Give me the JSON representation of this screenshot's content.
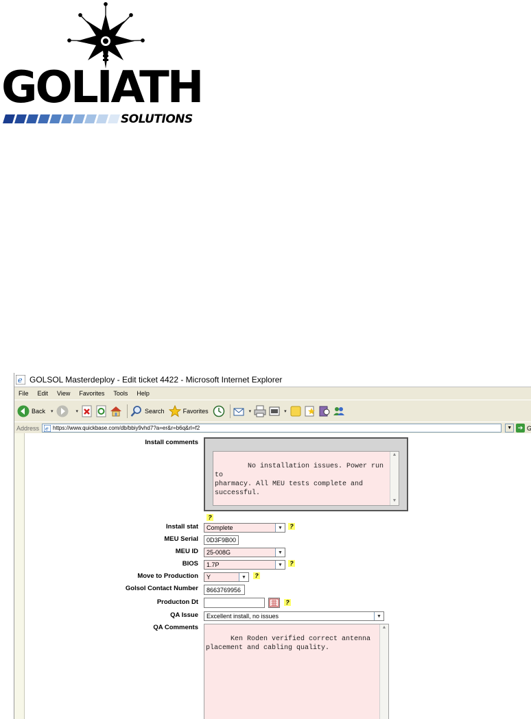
{
  "logo": {
    "main_text": "GOLIATH",
    "sub_text": "SOLUTIONS"
  },
  "window": {
    "title": "GOLSOL Masterdeploy - Edit ticket 4422 - Microsoft Internet Explorer",
    "menu": [
      "File",
      "Edit",
      "View",
      "Favorites",
      "Tools",
      "Help"
    ],
    "toolbar": {
      "back": "Back",
      "search": "Search",
      "favorites": "Favorites"
    },
    "address_label": "Address",
    "address_url": "https://www.quickbase.com/db/bbiy9vhd7?a=er&r=b6q&rl=f2",
    "go_label": "G"
  },
  "form": {
    "install_comments": {
      "label": "Install comments",
      "value": "No installation issues. Power run to\npharmacy. All MEU tests complete and\nsuccessful."
    },
    "install_stat": {
      "label": "Install stat",
      "value": "Complete"
    },
    "meu_serial": {
      "label": "MEU Serial",
      "value": "0D3F9B00"
    },
    "meu_id": {
      "label": "MEU ID",
      "value": "25-008G"
    },
    "bios": {
      "label": "BIOS",
      "value": "1.7P"
    },
    "move_to_production": {
      "label": "Move to Production",
      "value": "Y"
    },
    "golsol_contact": {
      "label": "Golsol Contact Number",
      "value": "8663769956"
    },
    "production_dt": {
      "label": "Producton Dt",
      "value": ""
    },
    "qa_issue": {
      "label": "QA Issue",
      "value": "Excellent install, no issues"
    },
    "qa_comments": {
      "label": "QA Comments",
      "value": "Ken Roden verified correct antenna\nplacement and cabling quality."
    },
    "help_symbol": "?"
  },
  "colors": {
    "field_bg": "#fde7e7",
    "help_bg": "#ffff66",
    "chrome": "#ece9d8"
  }
}
